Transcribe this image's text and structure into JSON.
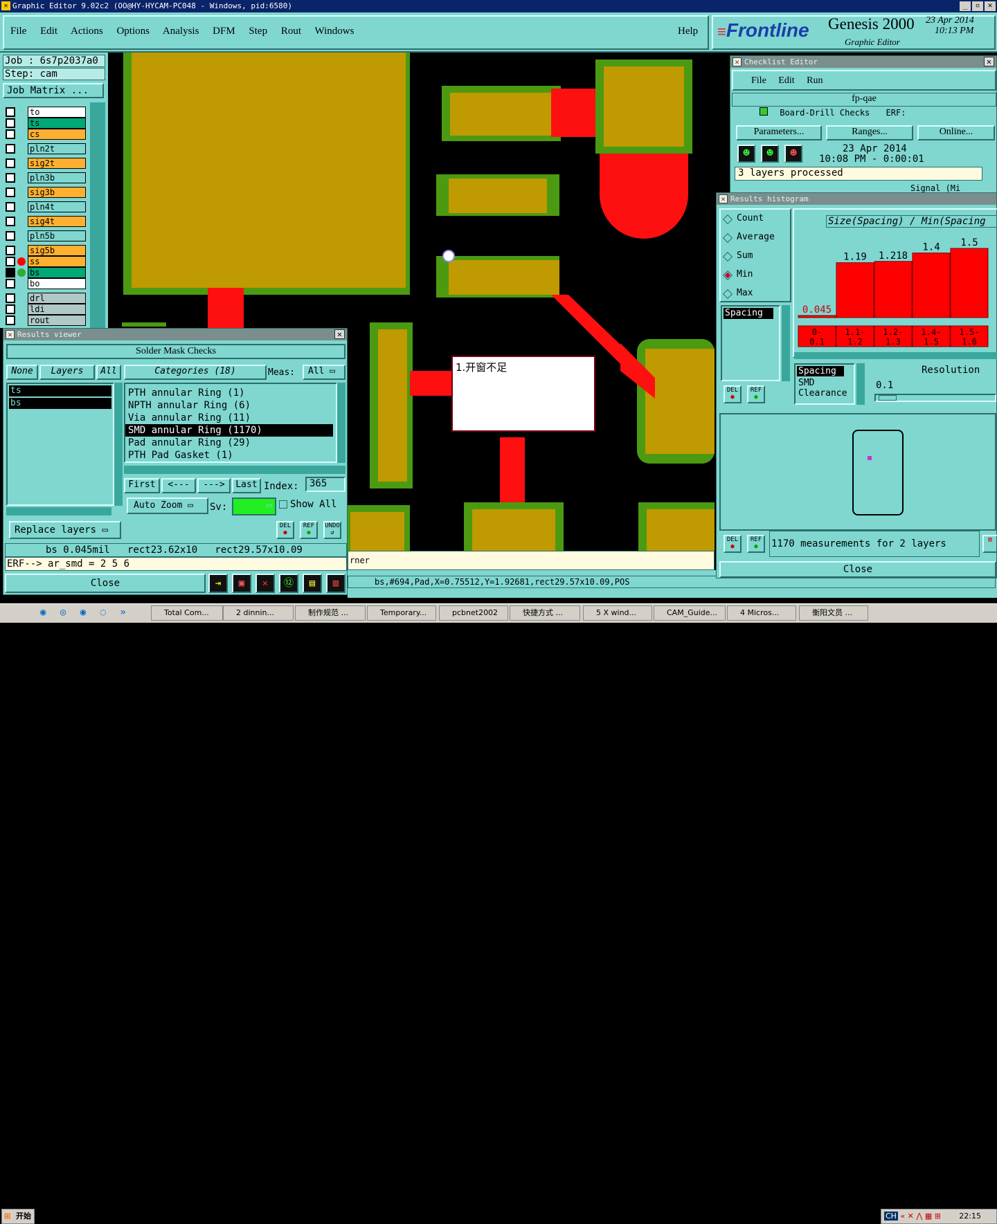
{
  "window": {
    "title": "Graphic Editor 9.02c2 (OO@HY-HYCAM-PC048 - Windows, pid:6580)"
  },
  "menubar": {
    "items": [
      "File",
      "Edit",
      "Actions",
      "Options",
      "Analysis",
      "DFM",
      "Step",
      "Rout",
      "Windows"
    ],
    "help": "Help"
  },
  "brand": {
    "logo": "Frontline",
    "product": "Genesis 2000",
    "subtitle": "Graphic Editor",
    "date": "23 Apr 2014",
    "time": "10:13 PM"
  },
  "job": {
    "job_label": "Job : 6s7p2037a0",
    "step_label": "Step: cam",
    "matrix_button": "Job Matrix ..."
  },
  "layers": [
    {
      "name": "to",
      "color": "#ffffff"
    },
    {
      "name": "ts",
      "color": "#00a878"
    },
    {
      "name": "cs",
      "color": "#ffb030"
    },
    {
      "name": "pln2t",
      "color": "#7fd7d0"
    },
    {
      "name": "sig2t",
      "color": "#ffb030"
    },
    {
      "name": "pln3b",
      "color": "#7fd7d0"
    },
    {
      "name": "sig3b",
      "color": "#ffb030"
    },
    {
      "name": "pln4t",
      "color": "#7fd7d0"
    },
    {
      "name": "sig4t",
      "color": "#ffb030"
    },
    {
      "name": "pln5b",
      "color": "#7fd7d0"
    },
    {
      "name": "sig5b",
      "color": "#ffb030"
    },
    {
      "name": "ss",
      "color": "#ffb030"
    },
    {
      "name": "bs",
      "color": "#00a878"
    },
    {
      "name": "bo",
      "color": "#ffffff"
    },
    {
      "name": "drl",
      "color": "#b0c8c6"
    },
    {
      "name": "ldi",
      "color": "#b0c8c6"
    },
    {
      "name": "rout",
      "color": "#b0c8c6"
    }
  ],
  "annotation": {
    "text": "1.开窗不足"
  },
  "results_viewer": {
    "title": "Results viewer",
    "header": "Solder Mask Checks",
    "tabs": {
      "none": "None",
      "layers": "Layers",
      "all": "All"
    },
    "layer_list": [
      "ts",
      "bs"
    ],
    "categories_label": "Categories (18)",
    "meas_label": "Meas:",
    "meas_value": "All",
    "categories": [
      "PTH annular Ring (1)",
      "NPTH annular Ring (6)",
      "Via annular Ring (11)",
      "SMD annular Ring (1170)",
      "Pad annular Ring (29)",
      "PTH Pad Gasket (1)"
    ],
    "nav": {
      "first": "First",
      "prev": "<---",
      "next": "--->",
      "last": "Last",
      "index_label": "Index:",
      "index_value": "365"
    },
    "auto_zoom": "Auto Zoom",
    "sv_label": "Sv:",
    "show_all": "Show All",
    "replace_layers": "Replace layers",
    "status1": "bs 0.045mil   rect23.62x10   rect29.57x10.09",
    "status2": "ERF--> ar_smd = 2 5 6",
    "close": "Close",
    "icon_labels": {
      "del": "DEL",
      "ref": "REF",
      "undo": "UNDO"
    }
  },
  "checklist": {
    "title": "Checklist Editor",
    "menu": [
      "File",
      "Edit",
      "Run"
    ],
    "name": "fp-qae",
    "row_text": "Board-Drill Checks",
    "row_erf": "ERF:",
    "buttons": {
      "parameters": "Parameters...",
      "ranges": "Ranges...",
      "online": "Online..."
    },
    "run_date": "23 Apr 2014",
    "run_time": "10:08 PM - 0:00:01",
    "processed": "3 layers processed",
    "row2_text": "Signal (Mi"
  },
  "histogram": {
    "title": "Results histogram",
    "modes": [
      "Count",
      "Average",
      "Sum",
      "Min",
      "Max"
    ],
    "selected_mode": "Min",
    "chart_title": "Size(Spacing) / Min(Spacing",
    "list": [
      "Spacing"
    ],
    "types": [
      "Spacing",
      "SMD",
      "Clearance"
    ],
    "resolution_label": "Resolution",
    "resolution_value": "0.1",
    "measurements": "1170 measurements for 2 layers",
    "close": "Close"
  },
  "chart_data": {
    "type": "bar",
    "title": "Size(Spacing) / Min(Spacing",
    "categories": [
      "0- 0.1",
      "1.1- 1.2",
      "1.2- 1.3",
      "1.4- 1.5",
      "1.5- 1.6"
    ],
    "values": [
      0.045,
      1.19,
      1.218,
      1.4,
      1.5
    ],
    "value_labels": [
      "0.045",
      "1.19",
      "1.218",
      "1.4",
      "1.5"
    ],
    "ylim": [
      0,
      1.8
    ],
    "bar_color": "#ff0000"
  },
  "canvas_status": {
    "info": "bs,#694,Pad,X=0.75512,Y=1.92681,rect29.57x10.09,POS",
    "partial": "rner"
  },
  "taskbar": {
    "start": "开始",
    "items": [
      "Total Com...",
      "2 dinnin...",
      "制作规范 ...",
      "Temporary...",
      "pcbnet2002",
      "快捷方式 ...",
      "5 X wind...",
      "CAM_Guide...",
      "4 Micros...",
      "衡阳文员 ..."
    ],
    "clock": "22:15",
    "ime": "CH"
  }
}
